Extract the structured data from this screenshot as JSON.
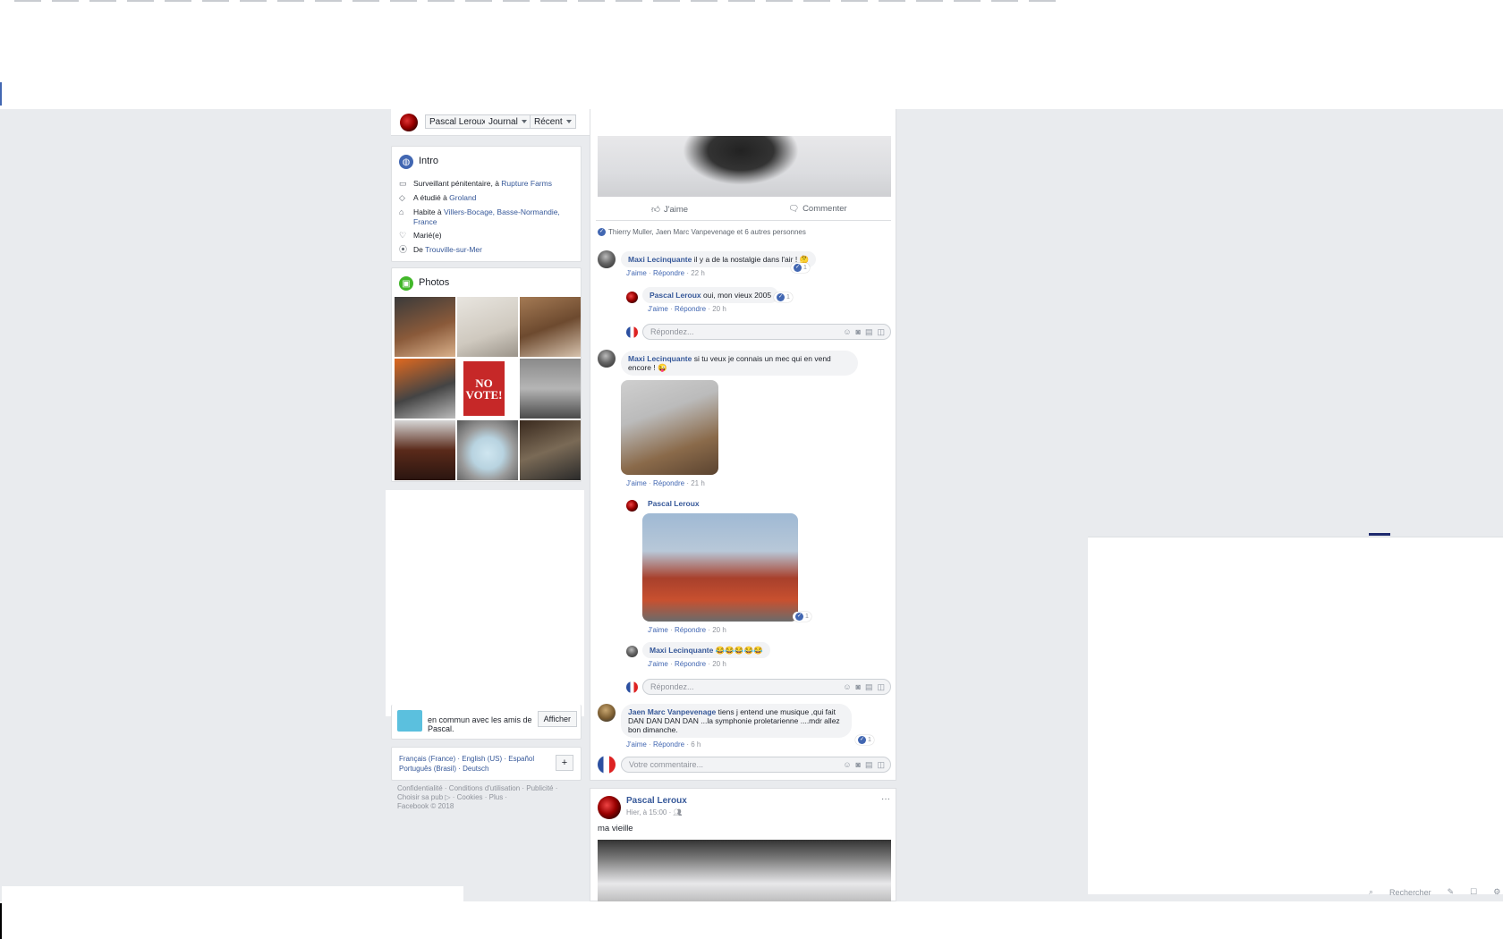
{
  "profile_nav": {
    "name": "Pascal Leroux",
    "journal": "Journal",
    "recent": "Récent"
  },
  "intro": {
    "title": "Intro",
    "rows": [
      {
        "text": "Surveillant pénitentaire, à ",
        "link": "Rupture Farms"
      },
      {
        "text": "A étudié à ",
        "link": "Groland"
      },
      {
        "text": "Habite à ",
        "link": "Villers-Bocage, Basse-Normandie, France"
      },
      {
        "text": "Marié(e)",
        "link": ""
      },
      {
        "text": "De ",
        "link": "Trouville-sur-Mer"
      }
    ]
  },
  "photos": {
    "title": "Photos",
    "poster_text": "NO VOTE!"
  },
  "friends_card": {
    "text": "en commun avec les amis de Pascal.",
    "button": "Afficher"
  },
  "languages": {
    "line1": "Français (France) · English (US) · Español",
    "line2": "Português (Brasil) · Deutsch",
    "plus": "+"
  },
  "footer": {
    "line1": "Confidentialité · Conditions d'utilisation · Publicité ·",
    "line2": "Choisir sa pub ▷ · Cookies · Plus ·",
    "line3": "Facebook © 2018"
  },
  "post1": {
    "like_label": "J'aime",
    "comment_label": "Commenter",
    "likers": "Thierry Muller, Jaen Marc Vanpevenage et 6 autres personnes",
    "comments": [
      {
        "author": "Maxi Lecinquante",
        "text": " il y a de la nostalgie dans l'air ! 🤔",
        "meta_like": "J'aime",
        "meta_reply": "Répondre",
        "time": "22 h",
        "likes": "1"
      },
      {
        "author": "Pascal Leroux",
        "text": " oui, mon vieux 2005",
        "meta_like": "J'aime",
        "meta_reply": "Répondre",
        "time": "20 h",
        "likes": "1"
      },
      {
        "author": "Maxi Lecinquante",
        "text": " si tu veux je connais un mec qui en vend encore ! 😜",
        "meta_like": "J'aime",
        "meta_reply": "Répondre",
        "time": "21 h"
      },
      {
        "author": "Pascal Leroux",
        "text": "",
        "meta_like": "J'aime",
        "meta_reply": "Répondre",
        "time": "20 h",
        "likes": "1"
      },
      {
        "author": "Maxi Lecinquante",
        "text": " 😂😂😂😂😂",
        "meta_like": "J'aime",
        "meta_reply": "Répondre",
        "time": "20 h"
      },
      {
        "author": "Jaen Marc Vanpevenage",
        "text": " tiens j entend une musique ,qui fait DAN DAN DAN DAN ...la symphonie proletarienne ....mdr allez bon dimanche.",
        "meta_like": "J'aime",
        "meta_reply": "Répondre",
        "time": "6 h",
        "likes": "1"
      }
    ],
    "reply_placeholder": "Répondez...",
    "comment_placeholder": "Votre commentaire..."
  },
  "post2": {
    "author": "Pascal Leroux",
    "time": "Hier, à 15:00 · ",
    "text": "ma vieille",
    "more": "···"
  },
  "right_footer": {
    "search": "Rechercher"
  },
  "colors": {
    "link": "#365899",
    "brand": "#4267b2",
    "background": "#e9ebee"
  }
}
